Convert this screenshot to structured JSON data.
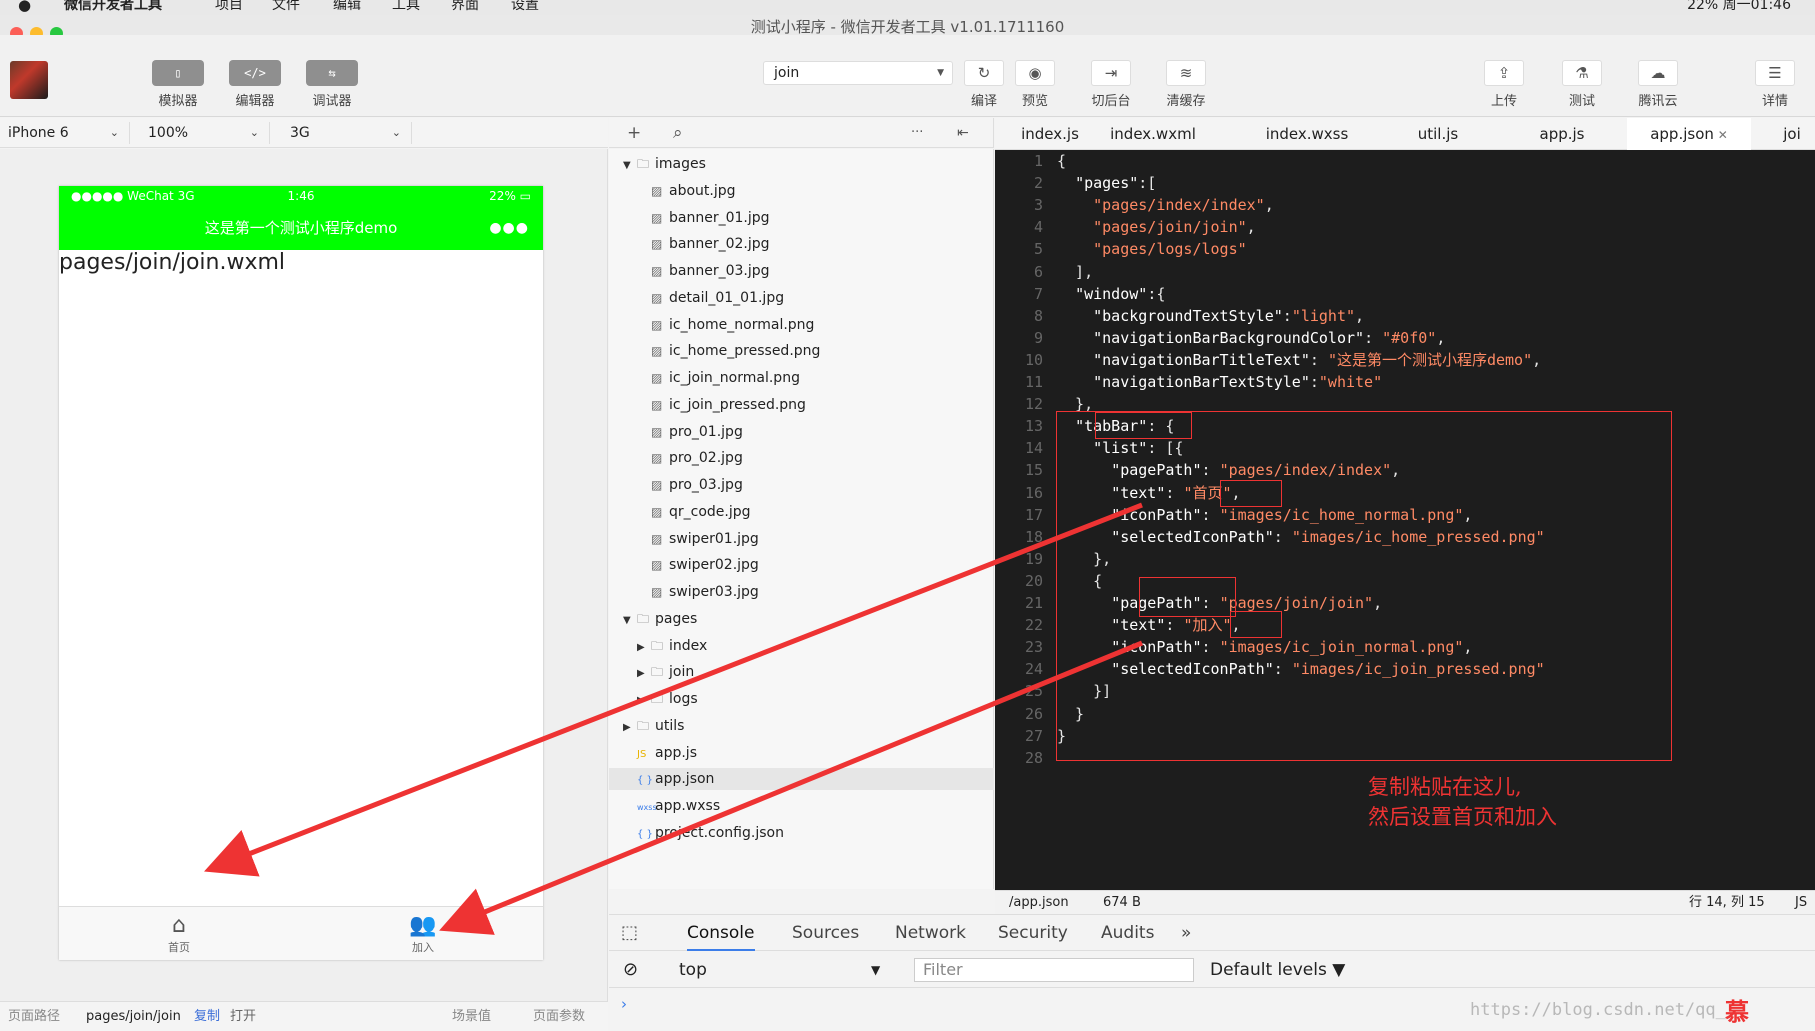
{
  "menubar": {
    "apple": "",
    "items": [
      "微信开发者工具",
      "项目",
      "文件",
      "编辑",
      "工具",
      "界面",
      "设置"
    ],
    "status": "22%    周一01:46"
  },
  "window": {
    "title": "测试小程序 - 微信开发者工具 v1.01.1711160"
  },
  "toolbar": {
    "left_buttons": [
      {
        "label": "模拟器",
        "icon": "phone-icon",
        "glyph": "▯"
      },
      {
        "label": "编辑器",
        "icon": "code-icon",
        "glyph": "</>"
      },
      {
        "label": "调试器",
        "icon": "debug-icon",
        "glyph": "⇆"
      }
    ],
    "project_select": "join",
    "center_buttons": [
      {
        "label": "编译",
        "icon": "compile-icon",
        "glyph": "↻"
      },
      {
        "label": "预览",
        "icon": "preview-icon",
        "glyph": "◉"
      },
      {
        "label": "切后台",
        "icon": "background-icon",
        "glyph": "⇥"
      },
      {
        "label": "清缓存",
        "icon": "clear-cache-icon",
        "glyph": "≋"
      }
    ],
    "right_buttons": [
      {
        "label": "上传",
        "icon": "upload-icon",
        "glyph": "⇪"
      },
      {
        "label": "测试",
        "icon": "test-icon",
        "glyph": "⚗"
      },
      {
        "label": "腾讯云",
        "icon": "cloud-icon",
        "glyph": "☁"
      },
      {
        "label": "详情",
        "icon": "details-icon",
        "glyph": "☰"
      }
    ]
  },
  "device_bar": {
    "device": "iPhone 6",
    "zoom": "100%",
    "network": "3G"
  },
  "simulator": {
    "status_left": "●●●●● WeChat 3G",
    "status_time": "1:46",
    "status_right": "22% ▭",
    "nav_title": "这是第一个测试小程序demo",
    "nav_dots": "●●●",
    "page_text": "pages/join/join.wxml",
    "nav_color": "#00ff00",
    "tabs": [
      {
        "label": "首页",
        "icon": "home-icon",
        "glyph": "⌂"
      },
      {
        "label": "加入",
        "icon": "people-icon",
        "glyph": "👥"
      }
    ]
  },
  "path_bar": {
    "label": "页面路径",
    "path": "pages/join/join",
    "copy": "复制",
    "open": "打开",
    "scene": "场景值",
    "params": "页面参数"
  },
  "file_tree": {
    "header": {
      "add": "+",
      "search": "⌕",
      "more": "···",
      "collapse": "⇤"
    },
    "items": [
      {
        "name": "images",
        "type": "folder",
        "open": true,
        "depth": 0
      },
      {
        "name": "about.jpg",
        "type": "image",
        "depth": 1
      },
      {
        "name": "banner_01.jpg",
        "type": "image",
        "depth": 1
      },
      {
        "name": "banner_02.jpg",
        "type": "image",
        "depth": 1
      },
      {
        "name": "banner_03.jpg",
        "type": "image",
        "depth": 1
      },
      {
        "name": "detail_01_01.jpg",
        "type": "image",
        "depth": 1
      },
      {
        "name": "ic_home_normal.png",
        "type": "image",
        "depth": 1
      },
      {
        "name": "ic_home_pressed.png",
        "type": "image",
        "depth": 1
      },
      {
        "name": "ic_join_normal.png",
        "type": "image",
        "depth": 1
      },
      {
        "name": "ic_join_pressed.png",
        "type": "image",
        "depth": 1
      },
      {
        "name": "pro_01.jpg",
        "type": "image",
        "depth": 1
      },
      {
        "name": "pro_02.jpg",
        "type": "image",
        "depth": 1
      },
      {
        "name": "pro_03.jpg",
        "type": "image",
        "depth": 1
      },
      {
        "name": "qr_code.jpg",
        "type": "image",
        "depth": 1
      },
      {
        "name": "swiper01.jpg",
        "type": "image",
        "depth": 1
      },
      {
        "name": "swiper02.jpg",
        "type": "image",
        "depth": 1
      },
      {
        "name": "swiper03.jpg",
        "type": "image",
        "depth": 1
      },
      {
        "name": "pages",
        "type": "folder",
        "open": true,
        "depth": 0
      },
      {
        "name": "index",
        "type": "folder",
        "open": false,
        "depth": 1
      },
      {
        "name": "join",
        "type": "folder",
        "open": false,
        "depth": 1
      },
      {
        "name": "logs",
        "type": "folder",
        "open": false,
        "depth": 1
      },
      {
        "name": "utils",
        "type": "folder",
        "open": false,
        "depth": 0
      },
      {
        "name": "app.js",
        "type": "js",
        "depth": 0
      },
      {
        "name": "app.json",
        "type": "json",
        "depth": 0,
        "selected": true
      },
      {
        "name": "app.wxss",
        "type": "wxss",
        "depth": 0
      },
      {
        "name": "project.config.json",
        "type": "json",
        "depth": 0
      }
    ]
  },
  "editor": {
    "tabs": [
      "index.js",
      "index.wxml",
      "index.wxss",
      "util.js",
      "app.js",
      "app.json",
      "joi"
    ],
    "active_tab": "app.json",
    "close_glyph": "✕",
    "lines": [
      "{",
      "  \"pages\":[",
      "    \"pages/index/index\",",
      "    \"pages/join/join\",",
      "    \"pages/logs/logs\"",
      "  ],",
      "  \"window\":{",
      "    \"backgroundTextStyle\":\"light\",",
      "    \"navigationBarBackgroundColor\": \"#0f0\",",
      "    \"navigationBarTitleText\": \"这是第一个测试小程序demo\",",
      "    \"navigationBarTextStyle\":\"white\"",
      "  },",
      "  \"tabBar\": {",
      "    \"list\": [{",
      "      \"pagePath\": \"pages/index/index\",",
      "      \"text\": \"首页\",",
      "      \"iconPath\": \"images/ic_home_normal.png\",",
      "      \"selectedIconPath\": \"images/ic_home_pressed.png\"",
      "    },",
      "    {",
      "      \"pagePath\": \"pages/join/join\",",
      "      \"text\": \"加入\",",
      "      \"iconPath\": \"images/ic_join_normal.png\",",
      "      \"selectedIconPath\": \"images/ic_join_pressed.png\"",
      "    }]",
      "  }",
      "}",
      ""
    ],
    "status": {
      "file": "/app.json",
      "size": "674 B",
      "cursor": "行 14, 列 15",
      "lang": "JS"
    },
    "annotation": [
      "复制粘贴在这儿,",
      "然后设置首页和加入"
    ]
  },
  "devtools": {
    "tabs": [
      "Console",
      "Sources",
      "Network",
      "Security",
      "Audits",
      "»"
    ],
    "active_tab": "Console",
    "context": "top",
    "filter_placeholder": "Filter",
    "levels": "Default levels ▼",
    "prompt": "›"
  },
  "watermark": "https://blog.csdn.net/qq_",
  "colors": {
    "accent": "#00ff00",
    "annotation": "#e33333",
    "editor_bg": "#1d1d1d"
  }
}
